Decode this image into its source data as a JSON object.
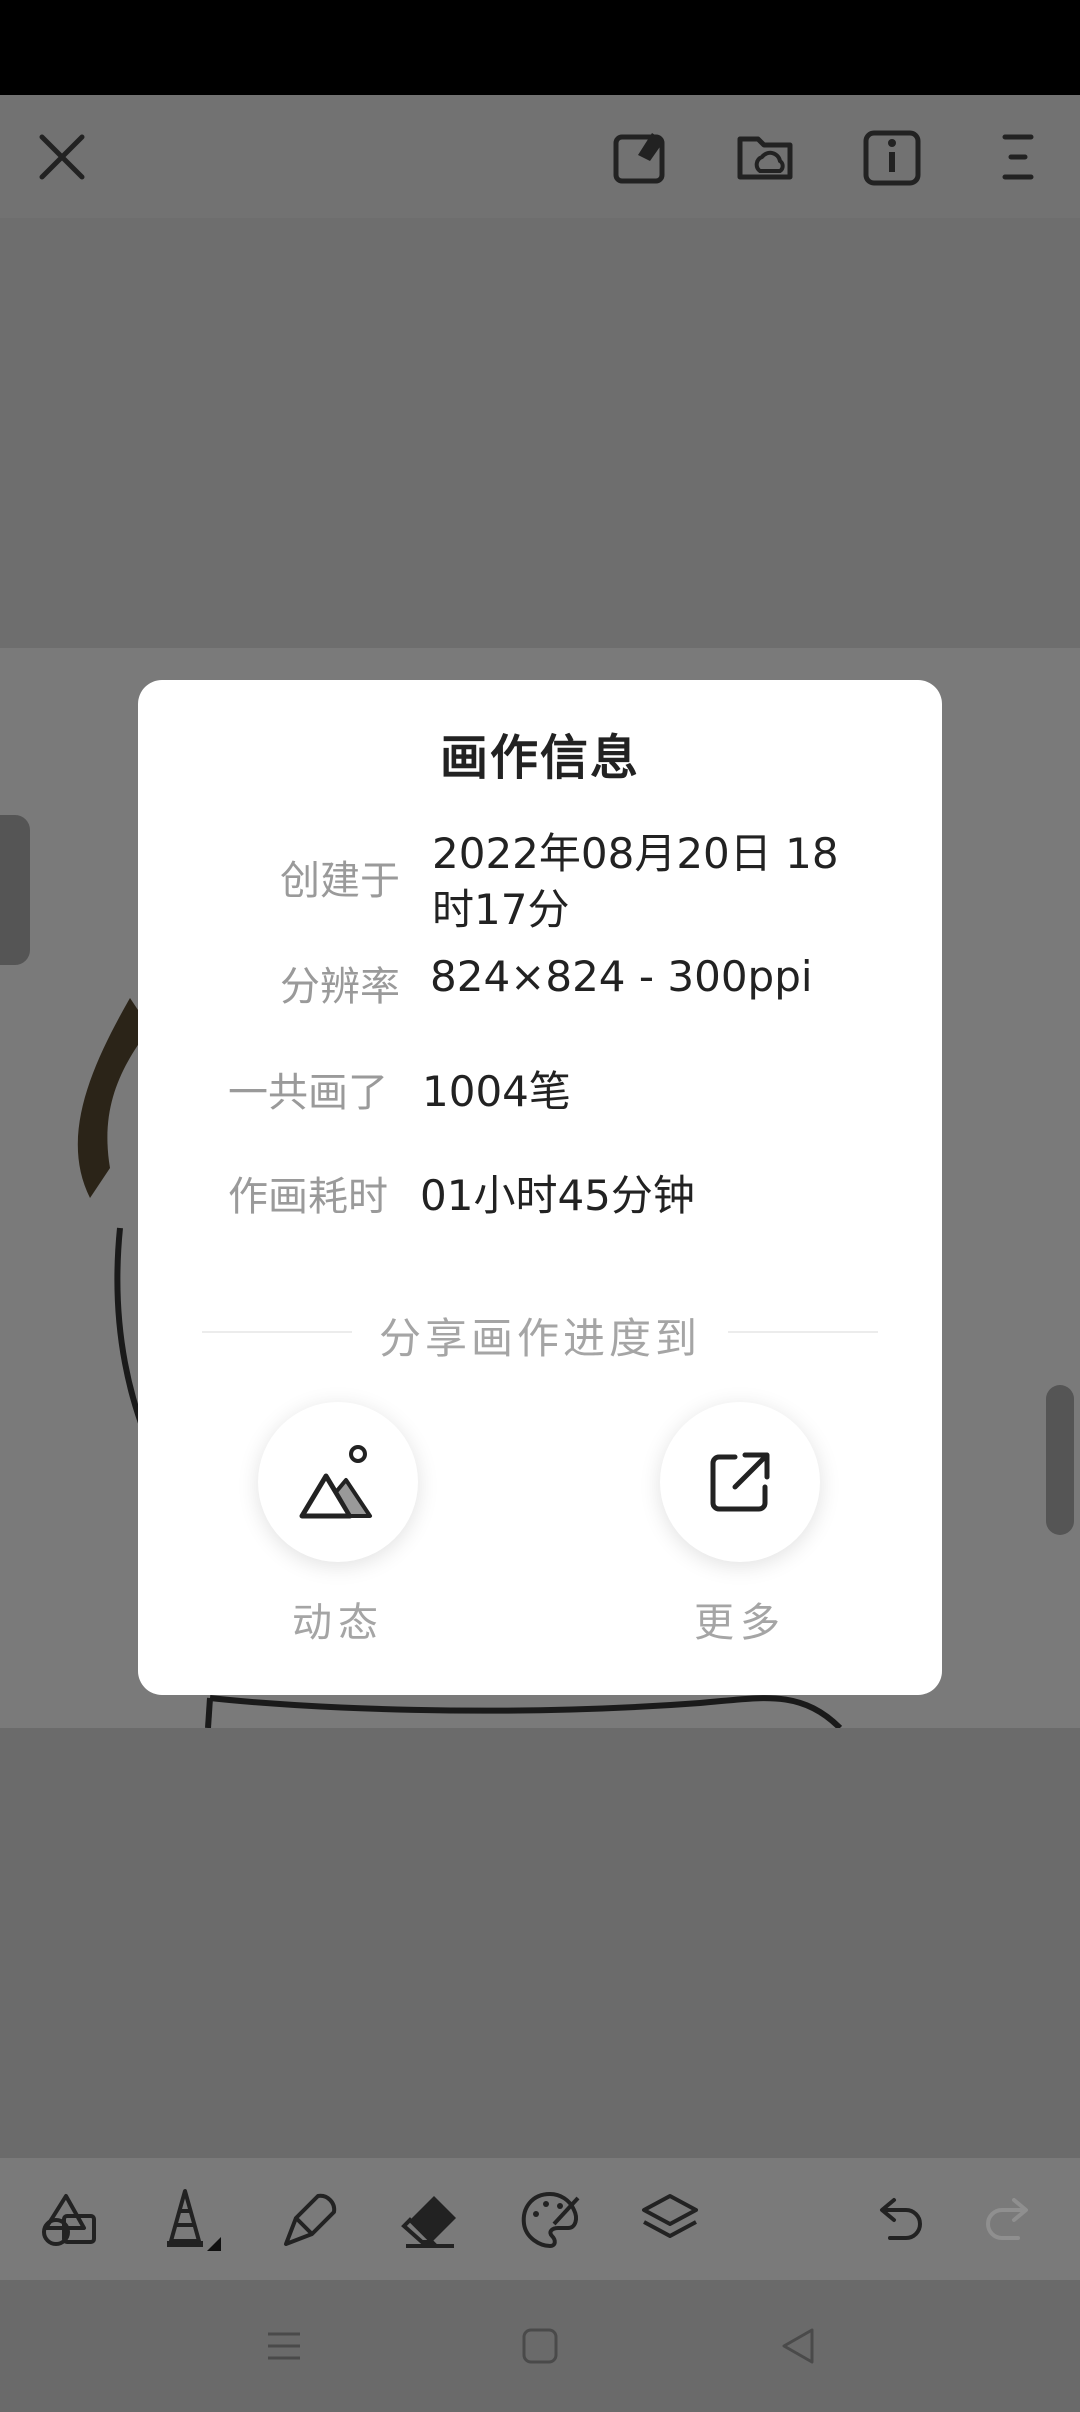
{
  "icons": {
    "close": "close-icon",
    "edit_canvas": "canvas-edit-icon",
    "cloud_folder": "cloud-folder-icon",
    "info": "info-icon",
    "menu": "menu-icon"
  },
  "dialog": {
    "title": "画作信息",
    "rows": [
      {
        "label": "创建于",
        "value_line1": "2022年08月20日  18",
        "value_line2": "时17分"
      },
      {
        "label": "分辨率",
        "value": "824×824 - 300ppi"
      },
      {
        "label": "一共画了",
        "value": "1004笔"
      },
      {
        "label": "作画耗时",
        "value": "01小时45分钟"
      }
    ],
    "share_title": "分享画作进度到",
    "share_options": [
      {
        "label": "动态",
        "icon": "mountain-image-icon"
      },
      {
        "label": "更多",
        "icon": "external-share-icon"
      }
    ]
  },
  "toolbar": {
    "tools": [
      "shapes-icon",
      "pen-tool-icon",
      "brush-icon",
      "eraser-icon",
      "palette-icon",
      "layers-icon",
      "undo-icon",
      "redo-icon"
    ]
  },
  "navbar": {
    "buttons": [
      "recent-apps-icon",
      "home-icon",
      "back-icon"
    ]
  }
}
